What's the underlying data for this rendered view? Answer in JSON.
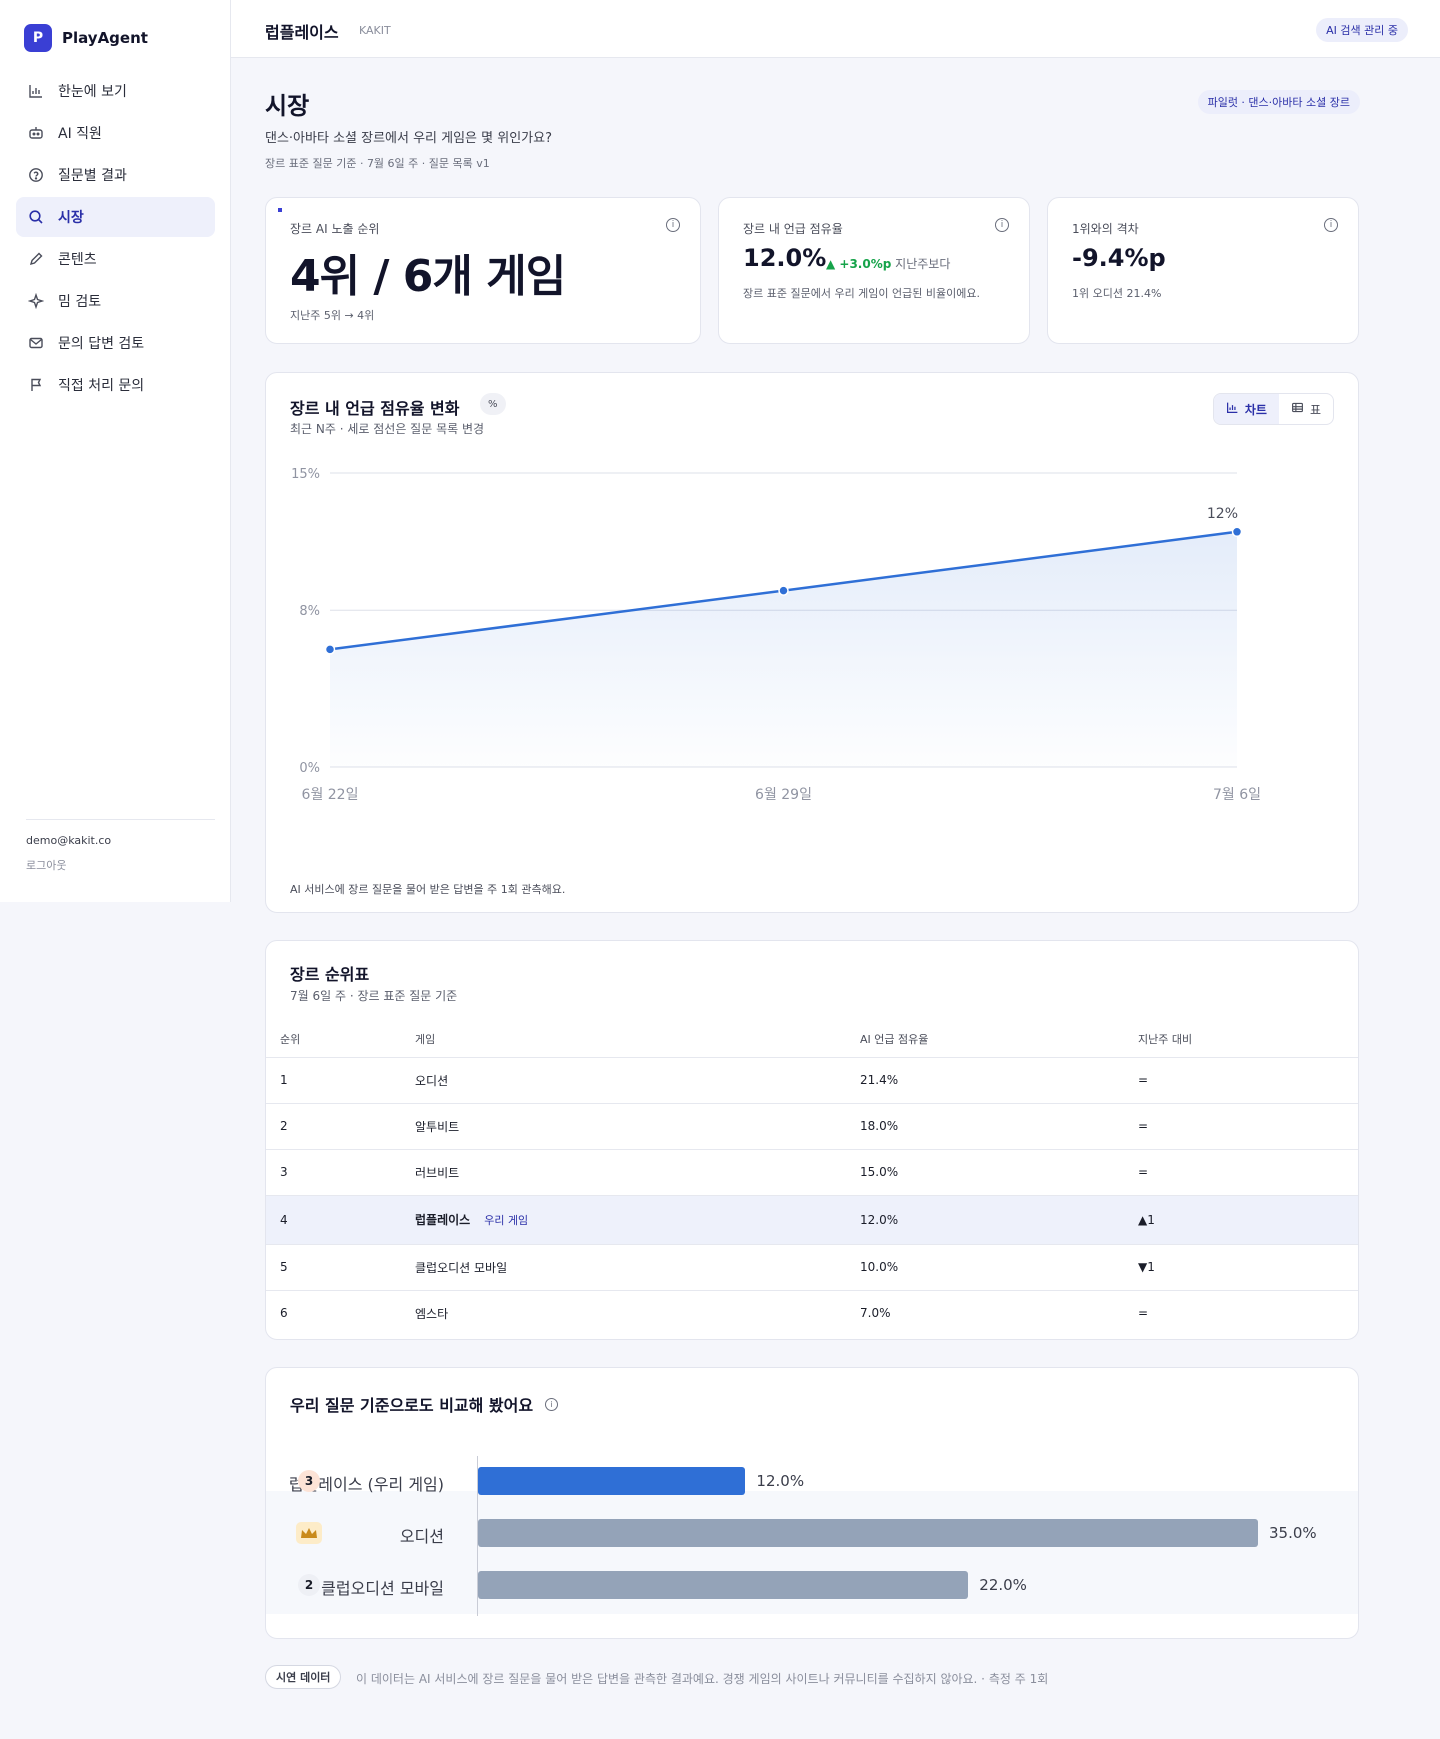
{
  "app": {
    "name": "PlayAgent",
    "logo_letter": "P"
  },
  "sidebar": {
    "items": [
      {
        "label": "한눈에 보기",
        "icon": "bar-chart-icon",
        "active": false
      },
      {
        "label": "AI 직원",
        "icon": "robot-icon",
        "active": false
      },
      {
        "label": "질문별 결과",
        "icon": "question-icon",
        "active": false
      },
      {
        "label": "시장",
        "icon": "search-icon",
        "active": true
      },
      {
        "label": "콘텐츠",
        "icon": "pencil-icon",
        "active": false
      },
      {
        "label": "밈 검토",
        "icon": "sparkle-icon",
        "active": false
      },
      {
        "label": "문의 답변 검토",
        "icon": "mail-icon",
        "active": false
      },
      {
        "label": "직접 처리 문의",
        "icon": "flag-icon",
        "active": false
      }
    ],
    "user_email": "demo@kakit.co",
    "logout": "로그아웃"
  },
  "header": {
    "title": "럽플레이스",
    "subtitle": "KAKIT",
    "status_badge": "AI 검색 관리 중"
  },
  "page": {
    "title": "시장",
    "question": "댄스·아바타 소셜 장르에서 우리 게임은 몇 위인가요?",
    "meta": "장르 표준 질문 기준 · 7월 6일 주 · 질문 목록 v1",
    "pilot_badge": "파일럿 · 댄스·아바타 소셜 장르"
  },
  "kpis": {
    "rank": {
      "label": "장르 AI 노출 순위",
      "value": "4위 / 6개 게임",
      "note": "지난주 5위 → 4위"
    },
    "share": {
      "label": "장르 내 언급 점유율",
      "value": "12.0%",
      "delta": "▲ +3.0%p",
      "delta_note": "지난주보다",
      "note": "장르 표준 질문에서 우리 게임이 언급된 비율이에요."
    },
    "gap": {
      "label": "1위와의 격차",
      "value": "-9.4%p",
      "note": "1위 오디션 21.4%"
    }
  },
  "trend": {
    "title": "장르 내 언급 점유율 변화",
    "unit": "%",
    "subtitle": "최근 N주 · 세로 점선은 질문 목록 변경",
    "toggle_chart": "차트",
    "toggle_table": "표",
    "footnote": "AI 서비스에 장르 질문을 물어 받은 답변을 주 1회 관측해요."
  },
  "chart_data": {
    "type": "area",
    "x": [
      "6월 22일",
      "6월 29일",
      "7월 6일"
    ],
    "values": [
      6,
      9,
      12
    ],
    "y_ticks": [
      "0%",
      "8%",
      "15%"
    ],
    "ylim": [
      0,
      15
    ],
    "last_label": "12%",
    "grid": true,
    "color": "#2f6fd6"
  },
  "ranking": {
    "title": "장르 순위표",
    "subtitle": "7월 6일 주 · 장르 표준 질문 기준",
    "columns": [
      "순위",
      "게임",
      "AI 언급 점유율",
      "지난주 대비"
    ],
    "rows": [
      {
        "rank": "1",
        "game": "오디션",
        "share": "21.4%",
        "change": "=",
        "ours": false
      },
      {
        "rank": "2",
        "game": "알투비트",
        "share": "18.0%",
        "change": "=",
        "ours": false
      },
      {
        "rank": "3",
        "game": "러브비트",
        "share": "15.0%",
        "change": "=",
        "ours": false
      },
      {
        "rank": "4",
        "game": "럽플레이스",
        "share": "12.0%",
        "change": "▲1",
        "ours": true,
        "tag": "우리 게임"
      },
      {
        "rank": "5",
        "game": "클럽오디션 모바일",
        "share": "10.0%",
        "change": "▼1",
        "ours": false
      },
      {
        "rank": "6",
        "game": "엠스타",
        "share": "7.0%",
        "change": "=",
        "ours": false
      }
    ]
  },
  "compare": {
    "title": "우리 질문 기준으로도 비교해 봤어요",
    "bars": [
      {
        "label": "럽플레이스 (우리 게임)",
        "value": 12.0,
        "value_label": "12.0%",
        "rank": "3",
        "ours": true
      },
      {
        "label": "오디션",
        "value": 35.0,
        "value_label": "35.0%",
        "rank": "crown",
        "ours": false
      },
      {
        "label": "클럽오디션 모바일",
        "value": 22.0,
        "value_label": "22.0%",
        "rank": "2",
        "ours": false
      }
    ],
    "max": 35.0
  },
  "footer": {
    "chip": "시연 데이터",
    "text": "이 데이터는 AI 서비스에 장르 질문을 물어 받은 답변을 관측한 결과예요. 경쟁 게임의 사이트나 커뮤니티를 수집하지 않아요. · 측정 주 1회"
  }
}
